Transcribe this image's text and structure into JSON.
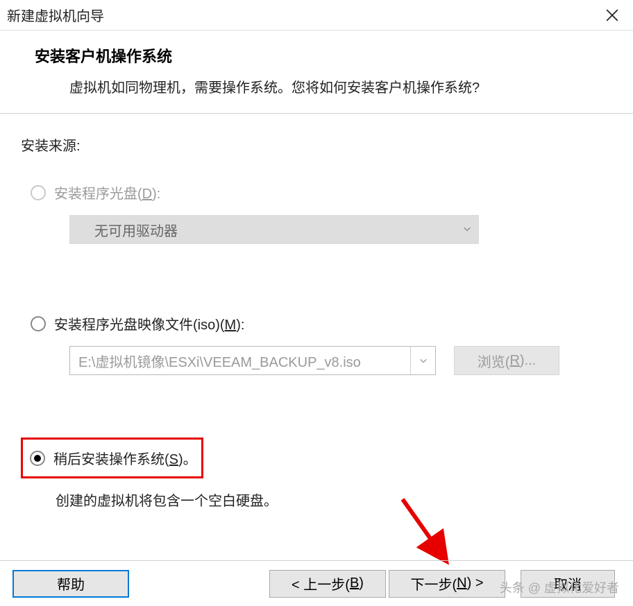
{
  "titlebar": {
    "title": "新建虚拟机向导"
  },
  "header": {
    "title": "安装客户机操作系统",
    "subtitle": "虚拟机如同物理机，需要操作系统。您将如何安装客户机操作系统?"
  },
  "content": {
    "source_label": "安装来源:",
    "option_disc": {
      "label_pre": "安装程序光盘(",
      "hotkey": "D",
      "label_post": "):"
    },
    "dropdown": {
      "text": "无可用驱动器"
    },
    "option_iso": {
      "label_pre": "安装程序光盘映像文件(iso)(",
      "hotkey": "M",
      "label_post": "):"
    },
    "iso_path": "E:\\虚拟机镜像\\ESXi\\VEEAM_BACKUP_v8.iso",
    "browse": {
      "label_pre": "浏览(",
      "hotkey": "R",
      "label_post": ")..."
    },
    "option_later": {
      "label_pre": "稍后安装操作系统(",
      "hotkey": "S",
      "label_post": ")。"
    },
    "later_desc": "创建的虚拟机将包含一个空白硬盘。"
  },
  "footer": {
    "help": "帮助",
    "back_pre": "< 上一步(",
    "back_hotkey": "B",
    "back_post": ")",
    "next_pre": "下一步(",
    "next_hotkey": "N",
    "next_post": ") >",
    "cancel": "取消"
  },
  "watermark": "头条 @ 虚拟化爱好者"
}
